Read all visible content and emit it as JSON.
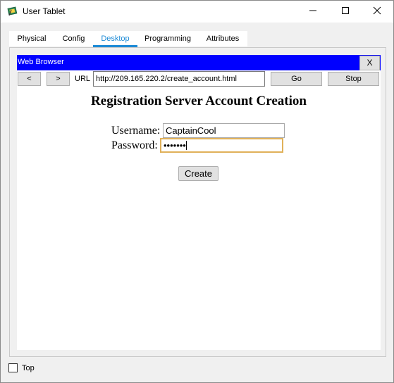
{
  "window": {
    "title": "User Tablet",
    "minimize_icon": "minimize-icon",
    "maximize_icon": "maximize-icon",
    "close_icon": "close-icon"
  },
  "tabs": [
    {
      "label": "Physical",
      "active": false
    },
    {
      "label": "Config",
      "active": false
    },
    {
      "label": "Desktop",
      "active": true
    },
    {
      "label": "Programming",
      "active": false
    },
    {
      "label": "Attributes",
      "active": false
    }
  ],
  "browser": {
    "title": "Web Browser",
    "close_label": "X",
    "back_label": "<",
    "forward_label": ">",
    "url_label": "URL",
    "url_value": "http://209.165.220.2/create_account.html",
    "go_label": "Go",
    "stop_label": "Stop",
    "header_color": "#0000ff"
  },
  "page": {
    "heading": "Registration Server Account Creation",
    "username_label": "Username:",
    "username_value": "CaptainCool",
    "password_label": "Password:",
    "password_value": "•••••••",
    "create_label": "Create"
  },
  "footer": {
    "top_label": "Top",
    "top_checked": false
  }
}
